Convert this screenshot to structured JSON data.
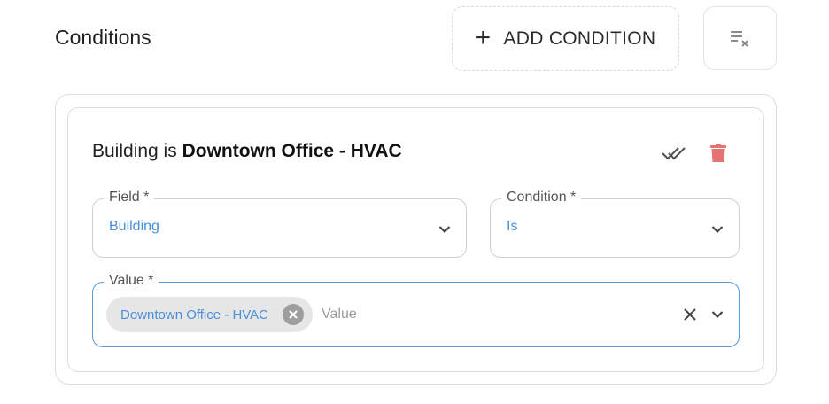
{
  "header": {
    "title": "Conditions",
    "add_label": "ADD CONDITION",
    "clear_icon": "clear-all-icon"
  },
  "condition": {
    "summary_prefix": "Building is",
    "summary_value": "Downtown Office - HVAC",
    "field": {
      "label": "Field *",
      "value": "Building"
    },
    "operator": {
      "label": "Condition *",
      "value": "Is"
    },
    "value": {
      "label": "Value *",
      "chips": [
        "Downtown Office - HVAC"
      ],
      "placeholder": "Value"
    }
  },
  "colors": {
    "accent": "#4a90d9",
    "delete": "#e57373",
    "border": "#dcdcdc"
  }
}
